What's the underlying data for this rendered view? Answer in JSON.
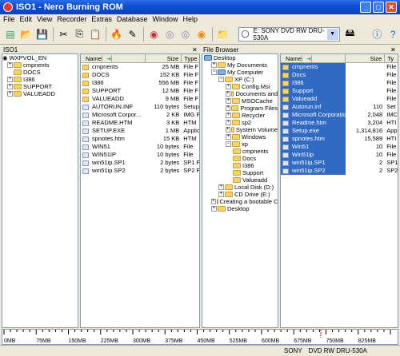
{
  "window": {
    "title": "ISO1 - Nero Burning ROM"
  },
  "menu": [
    "File",
    "Edit",
    "View",
    "Recorder",
    "Extras",
    "Database",
    "Window",
    "Help"
  ],
  "drive": {
    "label": "E: SONY      DVD RW DRU-530A"
  },
  "left_panel": {
    "title": "ISO1",
    "root": "WXPVOL_EN",
    "folders": [
      "cmpnents",
      "DOCS",
      "I386",
      "SUPPORT",
      "VALUEADD"
    ]
  },
  "left_files": {
    "headers": [
      "Name",
      "Size",
      "Type"
    ],
    "rows": [
      [
        "cmpnents",
        "25 MB",
        "File F"
      ],
      [
        "DOCS",
        "152 KB",
        "File F"
      ],
      [
        "I386",
        "556 MB",
        "File F"
      ],
      [
        "SUPPORT",
        "12 MB",
        "File F"
      ],
      [
        "VALUEADD",
        "9 MB",
        "File F"
      ],
      [
        "AUTORUN.INF",
        "110 bytes",
        "Setup"
      ],
      [
        "Microsoft Corpor...",
        "2 KB",
        "IMG F"
      ],
      [
        "README.HTM",
        "3 KB",
        "HTM"
      ],
      [
        "SETUP.EXE",
        "1 MB",
        "Applic"
      ],
      [
        "spnotes.htm",
        "15 KB",
        "HTM"
      ],
      [
        "WIN51",
        "10 bytes",
        "File"
      ],
      [
        "WIN51IP",
        "10 bytes",
        "File"
      ],
      [
        "win51ip.SP1",
        "2 bytes",
        "SP1 F"
      ],
      [
        "win51ip.SP2",
        "2 bytes",
        "SP2 F"
      ]
    ]
  },
  "browser": {
    "title": "File Browser",
    "items": [
      [
        "Desktop",
        0
      ],
      [
        "My Documents",
        1
      ],
      [
        "My Computer",
        1
      ],
      [
        "XP (C:)",
        2
      ],
      [
        "Config.Msi",
        3
      ],
      [
        "Documents and",
        3
      ],
      [
        "MSOCache",
        3
      ],
      [
        "Program Files",
        3
      ],
      [
        "Recycler",
        3
      ],
      [
        "sp2",
        3
      ],
      [
        "System Volume",
        3
      ],
      [
        "Windows",
        3
      ],
      [
        "xp",
        3
      ],
      [
        "cmpnents",
        4
      ],
      [
        "Docs",
        4
      ],
      [
        "I386",
        4
      ],
      [
        "Support",
        4
      ],
      [
        "Valueadd",
        4
      ],
      [
        "Local Disk (D:)",
        2
      ],
      [
        "CD Drive (E:)",
        2
      ],
      [
        "Creating a bootable CI",
        1
      ],
      [
        "Desktop",
        1
      ]
    ]
  },
  "right_files": {
    "headers": [
      "Name",
      "Size",
      "Ty"
    ],
    "rows": [
      [
        "cmpnents",
        "",
        "File"
      ],
      [
        "Docs",
        "",
        "File"
      ],
      [
        "I386",
        "",
        "File"
      ],
      [
        "Support",
        "",
        "File"
      ],
      [
        "Valueadd",
        "",
        "File"
      ],
      [
        "Autorun.inf",
        "110",
        "Set"
      ],
      [
        "Microsoft Corporation...",
        "2,048",
        "IMC"
      ],
      [
        "Readme.htm",
        "3,204",
        "HTI"
      ],
      [
        "Setup.exe",
        "1,314,816",
        "App"
      ],
      [
        "spnotes.htm",
        "15,589",
        "HTI"
      ],
      [
        "Win51",
        "10",
        "File"
      ],
      [
        "Win51ip",
        "10",
        "File"
      ],
      [
        "win51ip.SP1",
        "2",
        "SP1"
      ],
      [
        "win51ip.SP2",
        "2",
        "SP2"
      ]
    ]
  },
  "ruler": {
    "ticks": [
      "0MB",
      "75MB",
      "150MB",
      "225MB",
      "300MB",
      "375MB",
      "450MB",
      "525MB",
      "600MB",
      "675MB",
      "750MB",
      "825MB"
    ]
  },
  "status": {
    "drive": "SONY",
    "model": "DVD RW DRU-530A"
  }
}
